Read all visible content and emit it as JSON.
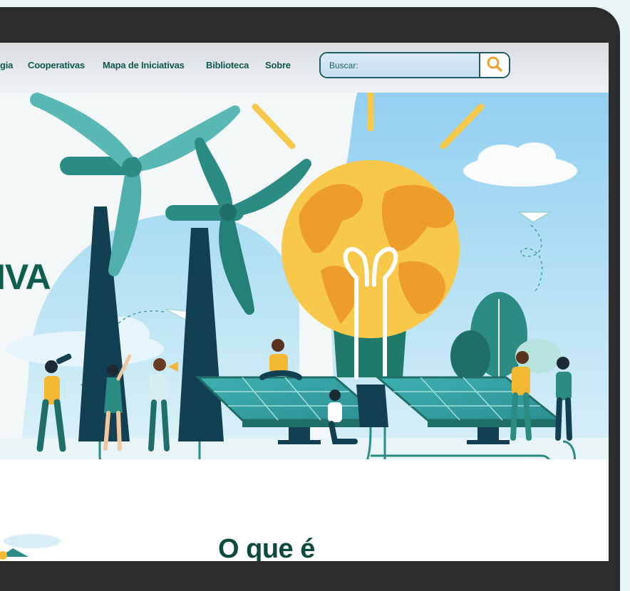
{
  "nav": {
    "links": [
      "gia",
      "Cooperativas",
      "Mapa de Iniciativas",
      "Biblioteca",
      "Sobre"
    ]
  },
  "search": {
    "placeholder": "Buscar:",
    "icon": "search-icon"
  },
  "hero": {
    "title_fragment": "IVA"
  },
  "section": {
    "title": "O que é"
  },
  "colors": {
    "brand_green": "#0e5a4c",
    "accent_orange": "#f0a22b",
    "sky_blue": "#9fd6f2",
    "bezel": "#2c2c2c"
  }
}
